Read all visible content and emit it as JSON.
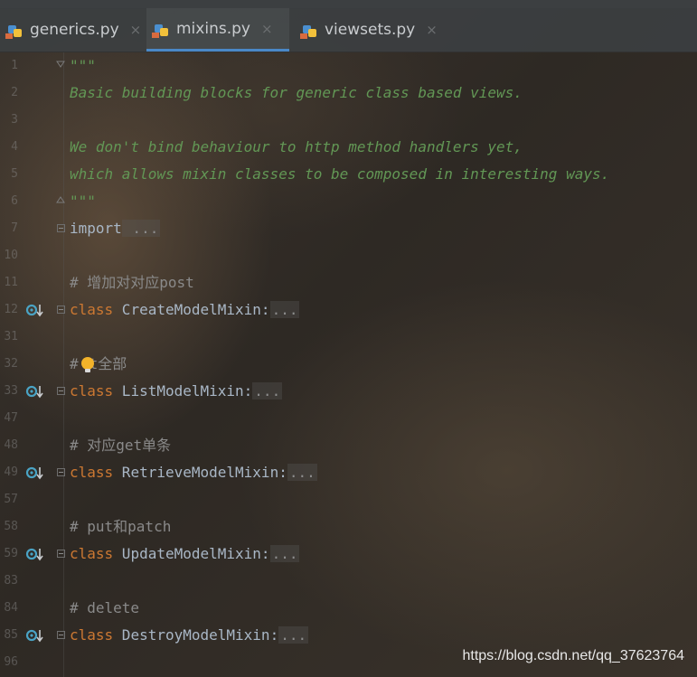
{
  "tabs": [
    {
      "label": "generics.py",
      "active": false
    },
    {
      "label": "mixins.py",
      "active": true
    },
    {
      "label": "viewsets.py",
      "active": false
    }
  ],
  "close_glyph": "×",
  "lines": {
    "l1": {
      "num": "1",
      "text": "\"\"\""
    },
    "l2": {
      "num": "2",
      "text": "Basic building blocks for generic class based views."
    },
    "l3": {
      "num": "3",
      "text": ""
    },
    "l4": {
      "num": "4",
      "text": "We don't bind behaviour to http method handlers yet,"
    },
    "l5": {
      "num": "5",
      "text": "which allows mixin classes to be composed in interesting ways."
    },
    "l6": {
      "num": "6",
      "text": "\"\"\""
    },
    "l7": {
      "num": "7",
      "kw": "import",
      "rest": " ..."
    },
    "l8": {
      "num": "10",
      "text": ""
    },
    "l9": {
      "num": "11",
      "text": "# 增加对对应post"
    },
    "l10": {
      "num": "12",
      "kw": "class",
      "name": " CreateModelMixin:",
      "dots": "..."
    },
    "l11": {
      "num": "31",
      "text": ""
    },
    "l12": {
      "num": "32",
      "text_pre": "#",
      "text_post": "t全部"
    },
    "l13": {
      "num": "33",
      "kw": "class",
      "name": " ListModelMixin:",
      "dots": "..."
    },
    "l14": {
      "num": "47",
      "text": ""
    },
    "l15": {
      "num": "48",
      "text": "# 对应get单条"
    },
    "l16": {
      "num": "49",
      "kw": "class",
      "name": " RetrieveModelMixin:",
      "dots": "..."
    },
    "l17": {
      "num": "57",
      "text": ""
    },
    "l18": {
      "num": "58",
      "text": "# put和patch"
    },
    "l19": {
      "num": "59",
      "kw": "class",
      "name": " UpdateModelMixin:",
      "dots": "..."
    },
    "l20": {
      "num": "83",
      "text": ""
    },
    "l21": {
      "num": "84",
      "text": "# delete"
    },
    "l22": {
      "num": "85",
      "kw": "class",
      "name": " DestroyModelMixin:",
      "dots": "..."
    },
    "l23": {
      "num": "96",
      "text": ""
    }
  },
  "watermark": "https://blog.csdn.net/qq_37623764",
  "colors": {
    "docstring": "#629755",
    "keyword": "#cc7832",
    "comment": "#8a8a8a",
    "identifier": "#a9b7c6",
    "active_tab_underline": "#4a88c7"
  },
  "icons": {
    "tab_file": "python-file-icon",
    "gutter": "implemented-method-icon",
    "intention": "lightbulb-icon"
  }
}
